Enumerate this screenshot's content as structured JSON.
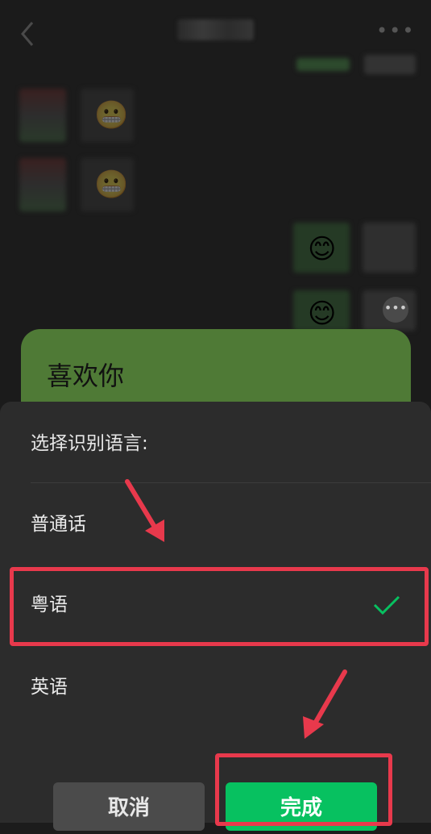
{
  "chat": {
    "message_text": "喜欢你",
    "more_glyph": "•••",
    "msg_more_glyph": "•••",
    "emoji": [
      "😬",
      "😬",
      "😊",
      "😊"
    ]
  },
  "sheet": {
    "title": "选择识别语言:",
    "options": [
      {
        "label": "普通话",
        "selected": false
      },
      {
        "label": "粤语",
        "selected": true
      },
      {
        "label": "英语",
        "selected": false
      }
    ],
    "cancel_label": "取消",
    "done_label": "完成"
  },
  "colors": {
    "accent": "#07c160",
    "highlight": "#e8394c",
    "bubble": "#4f7a36"
  }
}
